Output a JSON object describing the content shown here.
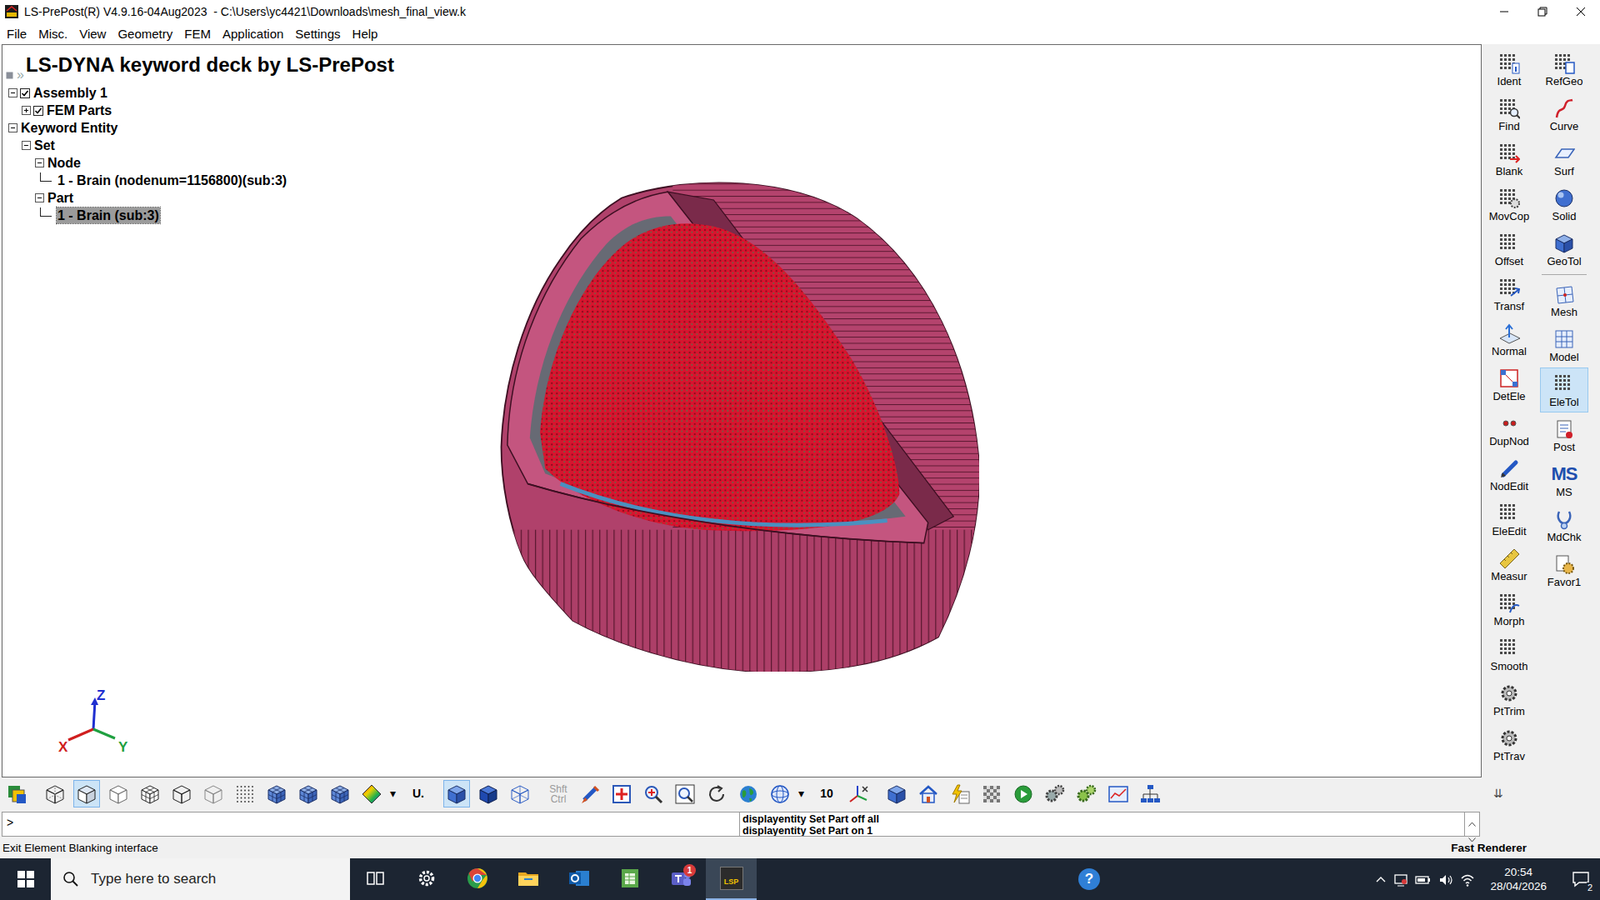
{
  "window": {
    "title": "LS-PrePost(R) V4.9.16-04Aug2023  - C:\\Users\\yc4421\\Downloads\\mesh_final_view.k"
  },
  "menu": [
    "File",
    "Misc.",
    "View",
    "Geometry",
    "FEM",
    "Application",
    "Settings",
    "Help"
  ],
  "canvas": {
    "heading": "LS-DYNA keyword deck by LS-PrePost",
    "panel_toggle": "»",
    "tree": [
      {
        "label": "Assembly 1",
        "level": 0,
        "kind": "check-branch",
        "expanded": true,
        "checked": true,
        "selected": false
      },
      {
        "label": "FEM Parts",
        "level": 1,
        "kind": "check-branch",
        "expanded": false,
        "checked": true,
        "selected": false
      },
      {
        "label": "Keyword Entity",
        "level": 0,
        "kind": "branch",
        "expanded": true,
        "selected": false
      },
      {
        "label": "Set",
        "level": 1,
        "kind": "branch",
        "expanded": true,
        "selected": false
      },
      {
        "label": "Node",
        "level": 2,
        "kind": "branch",
        "expanded": true,
        "selected": false
      },
      {
        "label": "1 - Brain (nodenum=1156800)(sub:3)",
        "level": 3,
        "kind": "leaf",
        "selected": false
      },
      {
        "label": "Part",
        "level": 2,
        "kind": "branch",
        "expanded": true,
        "selected": false
      },
      {
        "label": "1 - Brain (sub:3)",
        "level": 3,
        "kind": "leaf",
        "selected": true
      }
    ],
    "axes": {
      "x": "X",
      "y": "Y",
      "z": "Z"
    }
  },
  "right_toolbar": {
    "columns": [
      [
        [
          {
            "label": "Ident",
            "kind": "ident",
            "selected": false
          },
          {
            "label": "Find",
            "kind": "find",
            "selected": false
          },
          {
            "label": "Blank",
            "kind": "blank",
            "selected": false
          },
          {
            "label": "MovCop",
            "kind": "movcop",
            "selected": false
          },
          {
            "label": "Offset",
            "kind": "grid",
            "selected": false
          },
          {
            "label": "Transf",
            "kind": "transf",
            "selected": false
          },
          {
            "label": "Normal",
            "kind": "normal",
            "selected": false
          },
          {
            "label": "DetEle",
            "kind": "detele",
            "selected": false
          },
          {
            "label": "DupNod",
            "kind": "dupnod",
            "selected": false
          },
          {
            "label": "NodEdit",
            "kind": "pencil",
            "selected": false
          },
          {
            "label": "EleEdit",
            "kind": "grid",
            "selected": false
          },
          {
            "label": "Measur",
            "kind": "ruler",
            "selected": false
          },
          {
            "label": "Morph",
            "kind": "morph",
            "selected": false
          },
          {
            "label": "Smooth",
            "kind": "grid",
            "selected": false
          },
          {
            "label": "PtTrim",
            "kind": "gear",
            "selected": false
          },
          {
            "label": "PtTrav",
            "kind": "gear",
            "selected": false
          }
        ]
      ],
      [
        [
          {
            "label": "RefGeo",
            "kind": "refgeo",
            "selected": false
          },
          {
            "label": "Curve",
            "kind": "curve",
            "selected": false
          },
          {
            "label": "Surf",
            "kind": "surf",
            "selected": false
          },
          {
            "label": "Solid",
            "kind": "solid",
            "selected": false
          },
          {
            "label": "GeoTol",
            "kind": "geotol",
            "selected": false
          }
        ],
        [
          {
            "label": "Mesh",
            "kind": "mesh",
            "selected": false
          },
          {
            "label": "Model",
            "kind": "model",
            "selected": false
          },
          {
            "label": "EleTol",
            "kind": "grid",
            "selected": true
          },
          {
            "label": "Post",
            "kind": "post",
            "selected": false
          },
          {
            "label": "MS",
            "kind": "glyph",
            "glyph": "MS",
            "selected": false
          },
          {
            "label": "MdChk",
            "kind": "mdchk",
            "selected": false
          },
          {
            "label": "Favor1",
            "kind": "favor",
            "selected": false
          }
        ]
      ]
    ],
    "more": "⇊"
  },
  "bottom_toolbar": [
    [
      {
        "kind": "palette",
        "selected": false
      }
    ],
    [
      {
        "kind": "cube-wire",
        "selected": false
      },
      {
        "kind": "cube-shaded",
        "selected": true
      },
      {
        "kind": "cube-light",
        "selected": false
      },
      {
        "kind": "cube-mesh",
        "selected": false
      },
      {
        "kind": "cube-edge",
        "selected": false
      },
      {
        "kind": "cube-thin",
        "selected": false
      },
      {
        "kind": "dots",
        "selected": false
      },
      {
        "kind": "cube-blue-mesh",
        "selected": false
      },
      {
        "kind": "cube-blue-mesh",
        "selected": false
      },
      {
        "kind": "cube-blue-mesh",
        "selected": false
      },
      {
        "kind": "fringe",
        "selected": false
      },
      {
        "kind": "dropdown",
        "label": "▾",
        "selected": false
      },
      {
        "kind": "text",
        "label": "U.",
        "selected": false
      }
    ],
    [
      {
        "kind": "solid-blue",
        "selected": true
      },
      {
        "kind": "solid-blue-dark",
        "selected": false
      },
      {
        "kind": "wire-blue",
        "selected": false
      }
    ],
    [
      {
        "kind": "text",
        "label": "Shft Ctrl",
        "disabled": true,
        "selected": false
      },
      {
        "kind": "brush",
        "selected": false
      },
      {
        "kind": "plus",
        "selected": false
      },
      {
        "kind": "zoom",
        "selected": false
      },
      {
        "kind": "zoom-box",
        "selected": false
      },
      {
        "kind": "rotate",
        "selected": false
      },
      {
        "kind": "globe",
        "selected": false
      },
      {
        "kind": "sphere",
        "selected": false
      },
      {
        "kind": "dropdown",
        "label": "▾",
        "selected": false
      },
      {
        "kind": "text",
        "label": "10",
        "selected": false
      },
      {
        "kind": "axes",
        "selected": false
      }
    ],
    [
      {
        "kind": "solid-blue",
        "selected": false
      },
      {
        "kind": "home",
        "selected": false
      },
      {
        "kind": "lightning",
        "selected": false
      },
      {
        "kind": "checker",
        "selected": false
      },
      {
        "kind": "play",
        "selected": false
      },
      {
        "kind": "gears",
        "selected": false
      },
      {
        "kind": "gears-green",
        "selected": false
      },
      {
        "kind": "chart",
        "selected": false
      },
      {
        "kind": "tree",
        "selected": false
      }
    ]
  ],
  "command": {
    "prompt": ">",
    "log": [
      "displayentity Set Part off all",
      "displayentity Set Part on 1"
    ]
  },
  "status_bar": {
    "left": "Exit Element Blanking interface",
    "right": "Fast Renderer"
  },
  "taskbar": {
    "search": {
      "placeholder": "Type here to search"
    },
    "apps": [
      {
        "kind": "taskview",
        "active": false
      },
      {
        "kind": "settings",
        "active": false
      },
      {
        "kind": "chrome",
        "active": false
      },
      {
        "kind": "explorer",
        "active": false
      },
      {
        "kind": "outlook",
        "active": false
      },
      {
        "kind": "sheet",
        "active": false
      },
      {
        "kind": "teams",
        "active": false,
        "badge": "1"
      },
      {
        "kind": "lsprepost",
        "active": true,
        "label": "LSP"
      }
    ],
    "help": "?",
    "clock": {
      "time": "20:54",
      "date": "28/04/2026"
    },
    "notifications": "2"
  }
}
